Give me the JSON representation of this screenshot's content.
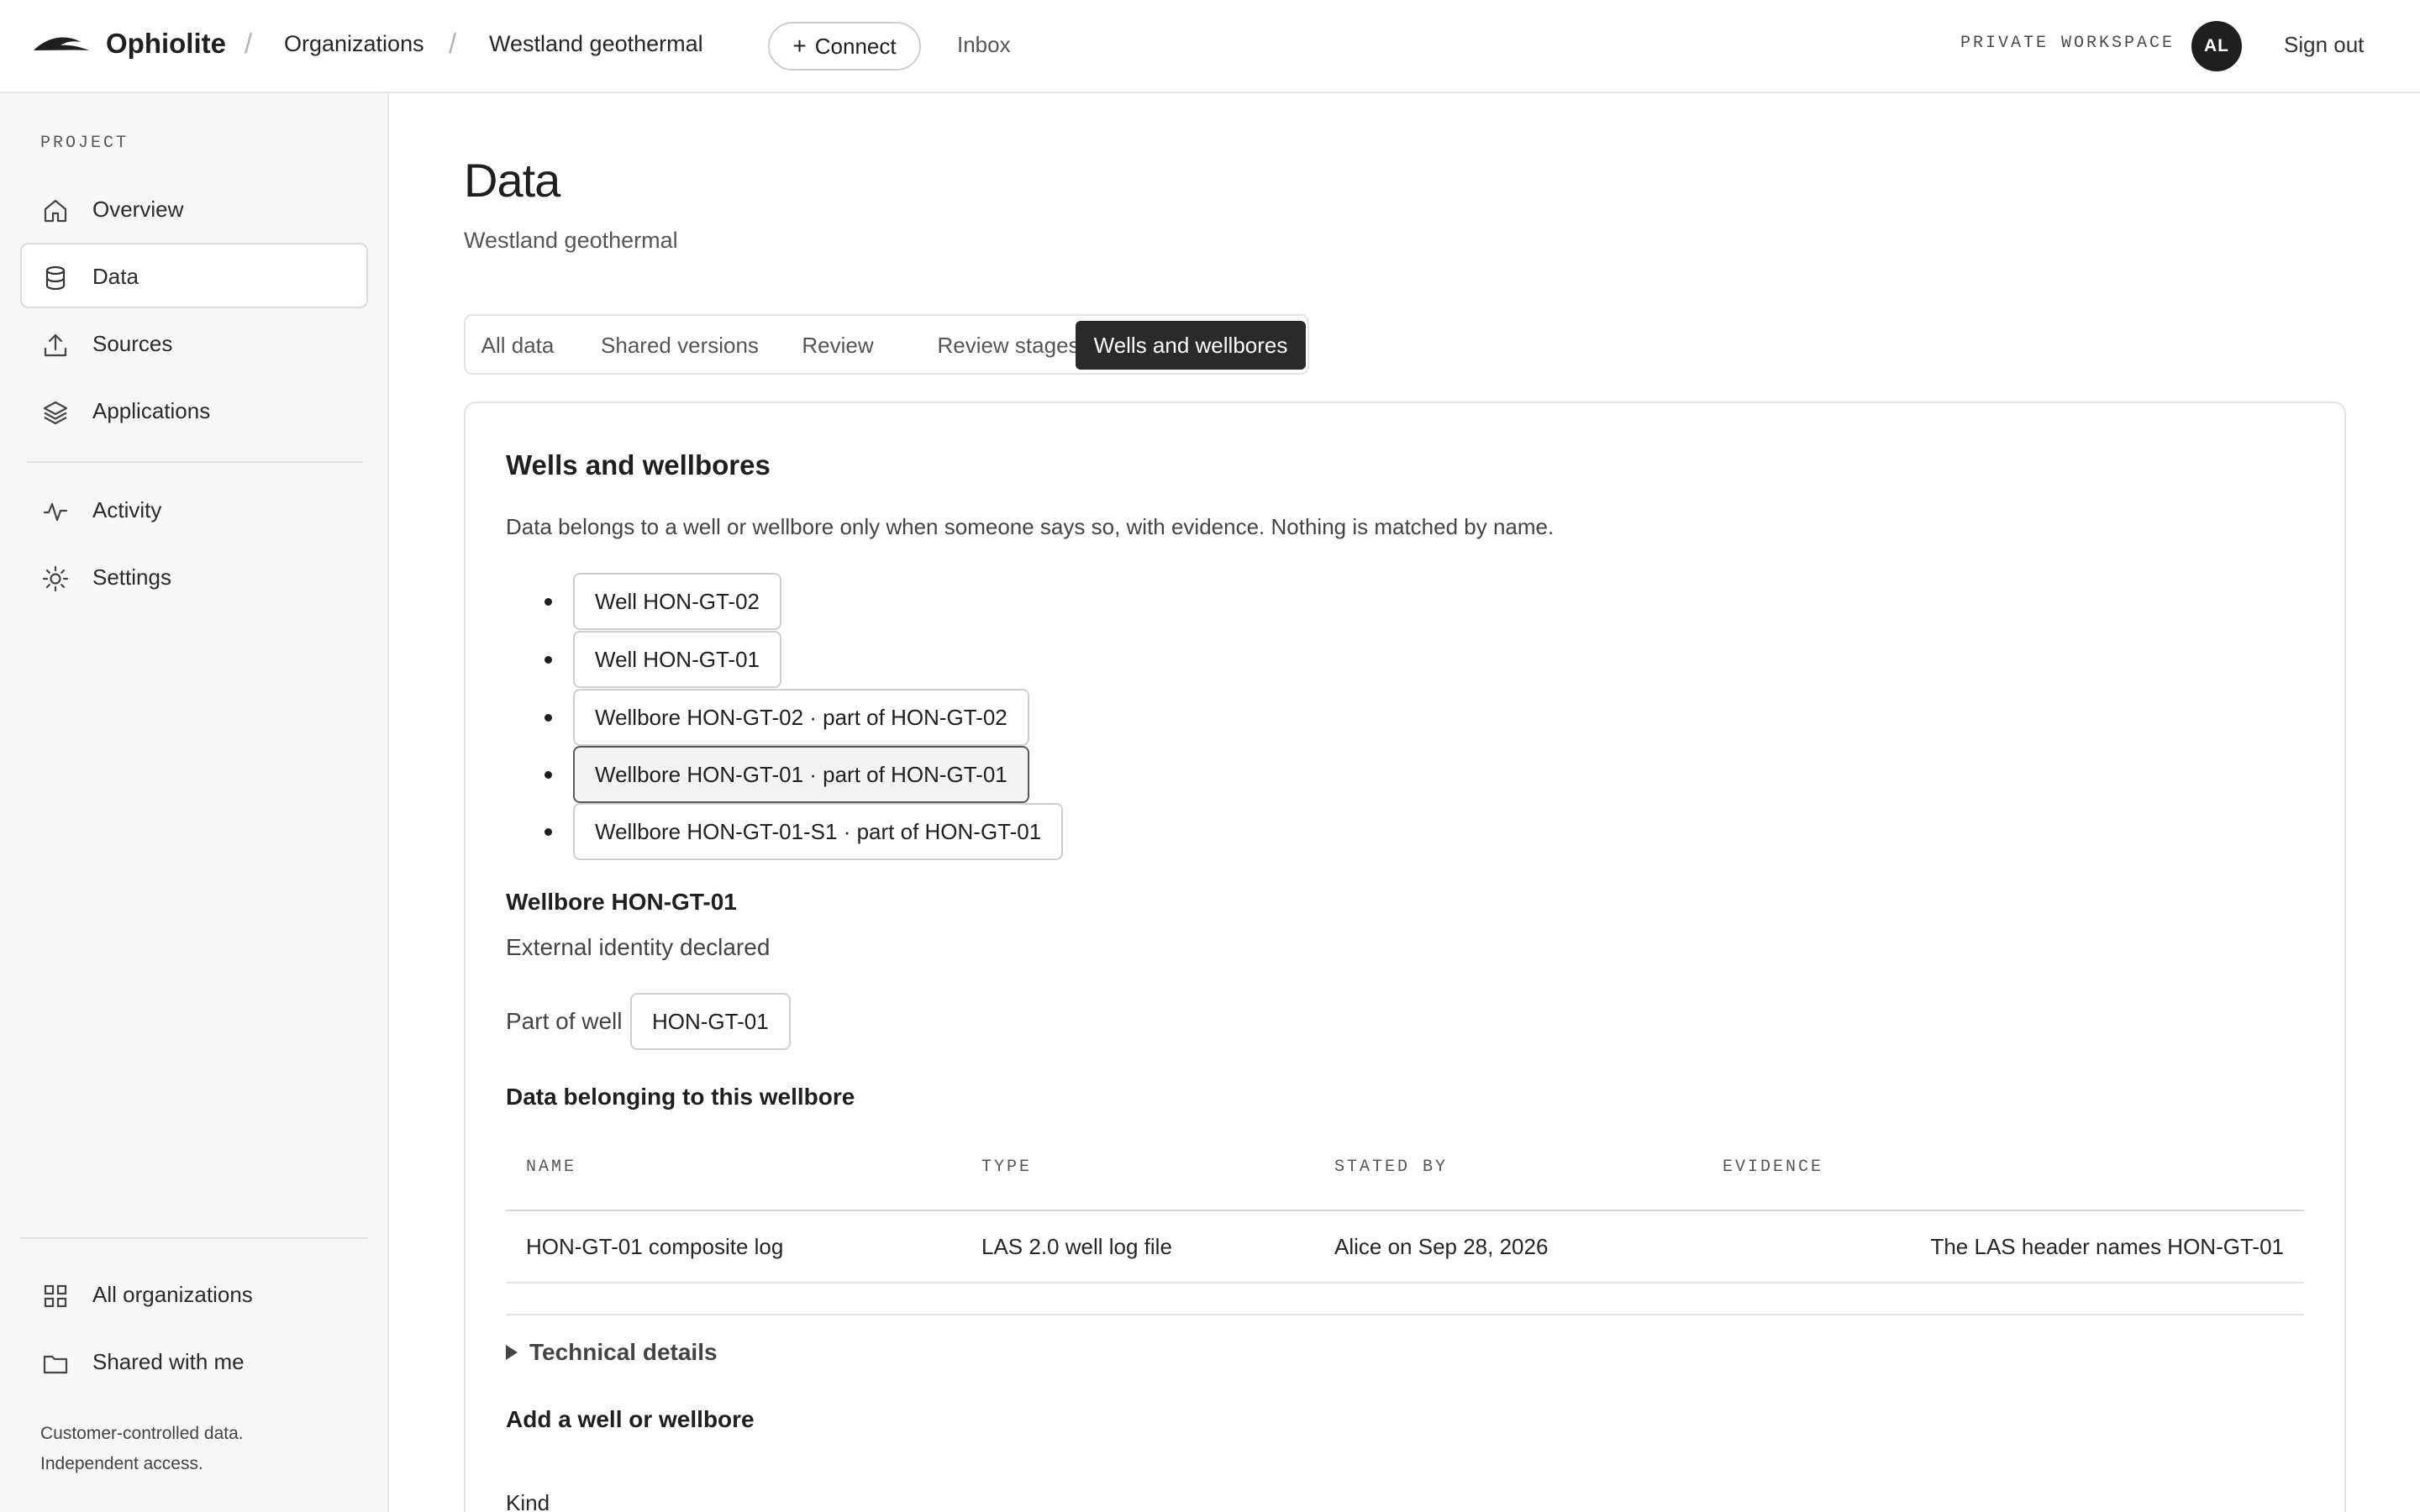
{
  "header": {
    "brand": "Ophiolite",
    "separator": "/",
    "breadcrumbs": [
      "Organizations",
      "Westland geothermal"
    ],
    "connect_icon": "+",
    "connect_label": "Connect",
    "inbox_label": "Inbox",
    "workspace_label": "PRIVATE WORKSPACE",
    "avatar_initials": "AL",
    "signout_label": "Sign out"
  },
  "sidebar": {
    "section_label": "PROJECT",
    "items": [
      {
        "label": "Overview",
        "icon": "home-icon"
      },
      {
        "label": "Data",
        "icon": "database-icon",
        "active": true
      },
      {
        "label": "Sources",
        "icon": "upload-icon"
      },
      {
        "label": "Applications",
        "icon": "layers-icon"
      },
      {
        "label": "Activity",
        "icon": "activity-icon"
      },
      {
        "label": "Settings",
        "icon": "sun-icon"
      }
    ],
    "bottom_items": [
      {
        "label": "All organizations",
        "icon": "grid-icon"
      },
      {
        "label": "Shared with me",
        "icon": "folder-icon"
      }
    ],
    "footer_lines": [
      "Customer-controlled data.",
      "Independent access."
    ]
  },
  "main": {
    "title": "Data",
    "subtitle": "Westland geothermal",
    "tabs": [
      "All data",
      "Shared versions",
      "Review",
      "Review stages",
      "Wells and wellbores"
    ],
    "active_tab": "Wells and wellbores"
  },
  "card": {
    "title": "Wells and wellbores",
    "description": "Data belongs to a well or wellbore only when someone says so, with evidence. Nothing is matched by name.",
    "entities": [
      "Well HON-GT-02",
      "Well HON-GT-01",
      "Wellbore HON-GT-02 · part of HON-GT-02",
      "Wellbore HON-GT-01 · part of HON-GT-01",
      "Wellbore HON-GT-01-S1 · part of HON-GT-01"
    ],
    "selected_entity": "Wellbore HON-GT-01 · part of HON-GT-01",
    "detail": {
      "title": "Wellbore HON-GT-01",
      "status": "External identity declared",
      "part_of_label": "Part of well",
      "part_of_value": "HON-GT-01",
      "belonging_title": "Data belonging to this wellbore"
    },
    "table": {
      "columns": [
        "NAME",
        "TYPE",
        "STATED BY",
        "EVIDENCE"
      ],
      "rows": [
        [
          "HON-GT-01 composite log",
          "LAS 2.0 well log file",
          "Alice on Sep 28, 2026",
          "The LAS header names HON-GT-01"
        ]
      ]
    },
    "technical_details_label": "Technical details",
    "add_title": "Add a well or wellbore",
    "kind_label": "Kind"
  },
  "colors": {
    "accent_dark": "#2a2a2a",
    "sidebar_bg": "#f7f7f7",
    "border": "#e3e3e3"
  }
}
